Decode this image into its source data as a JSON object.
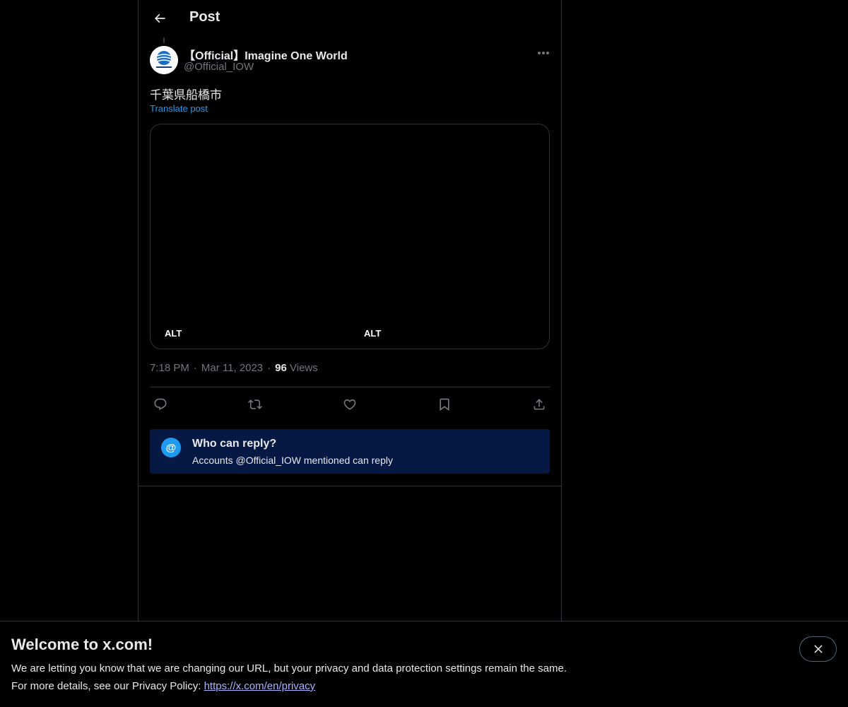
{
  "header": {
    "title": "Post",
    "back_icon": "arrow-left-icon"
  },
  "post": {
    "author": {
      "display_name": "【Official】Imagine One World",
      "handle": "@Official_IOW"
    },
    "text": "千葉県船橋市",
    "translate_label": "Translate post",
    "media": {
      "alt_labels": [
        "ALT",
        "ALT"
      ]
    },
    "meta": {
      "time": "7:18 PM",
      "separator": "·",
      "date": "Mar 11, 2023",
      "views_count": "96",
      "views_label": "Views"
    },
    "actions": [
      "reply-icon",
      "repost-icon",
      "like-icon",
      "bookmark-icon",
      "share-icon"
    ]
  },
  "reply_restriction": {
    "icon": "@",
    "title": "Who can reply?",
    "description": "Accounts @Official_IOW mentioned can reply"
  },
  "banner": {
    "title": "Welcome to x.com!",
    "line1": "We are letting you know that we are changing our URL, but your privacy and data protection settings remain the same.",
    "line2_prefix": "For more details, see our Privacy Policy: ",
    "link_text": "https://x.com/en/privacy",
    "close_icon": "close-icon"
  },
  "colors": {
    "background": "#000000",
    "text": "#e7e9ea",
    "secondary_text": "#71767b",
    "accent": "#1d9bf0",
    "border": "#2f3336",
    "reply_box_bg": "#061844"
  }
}
